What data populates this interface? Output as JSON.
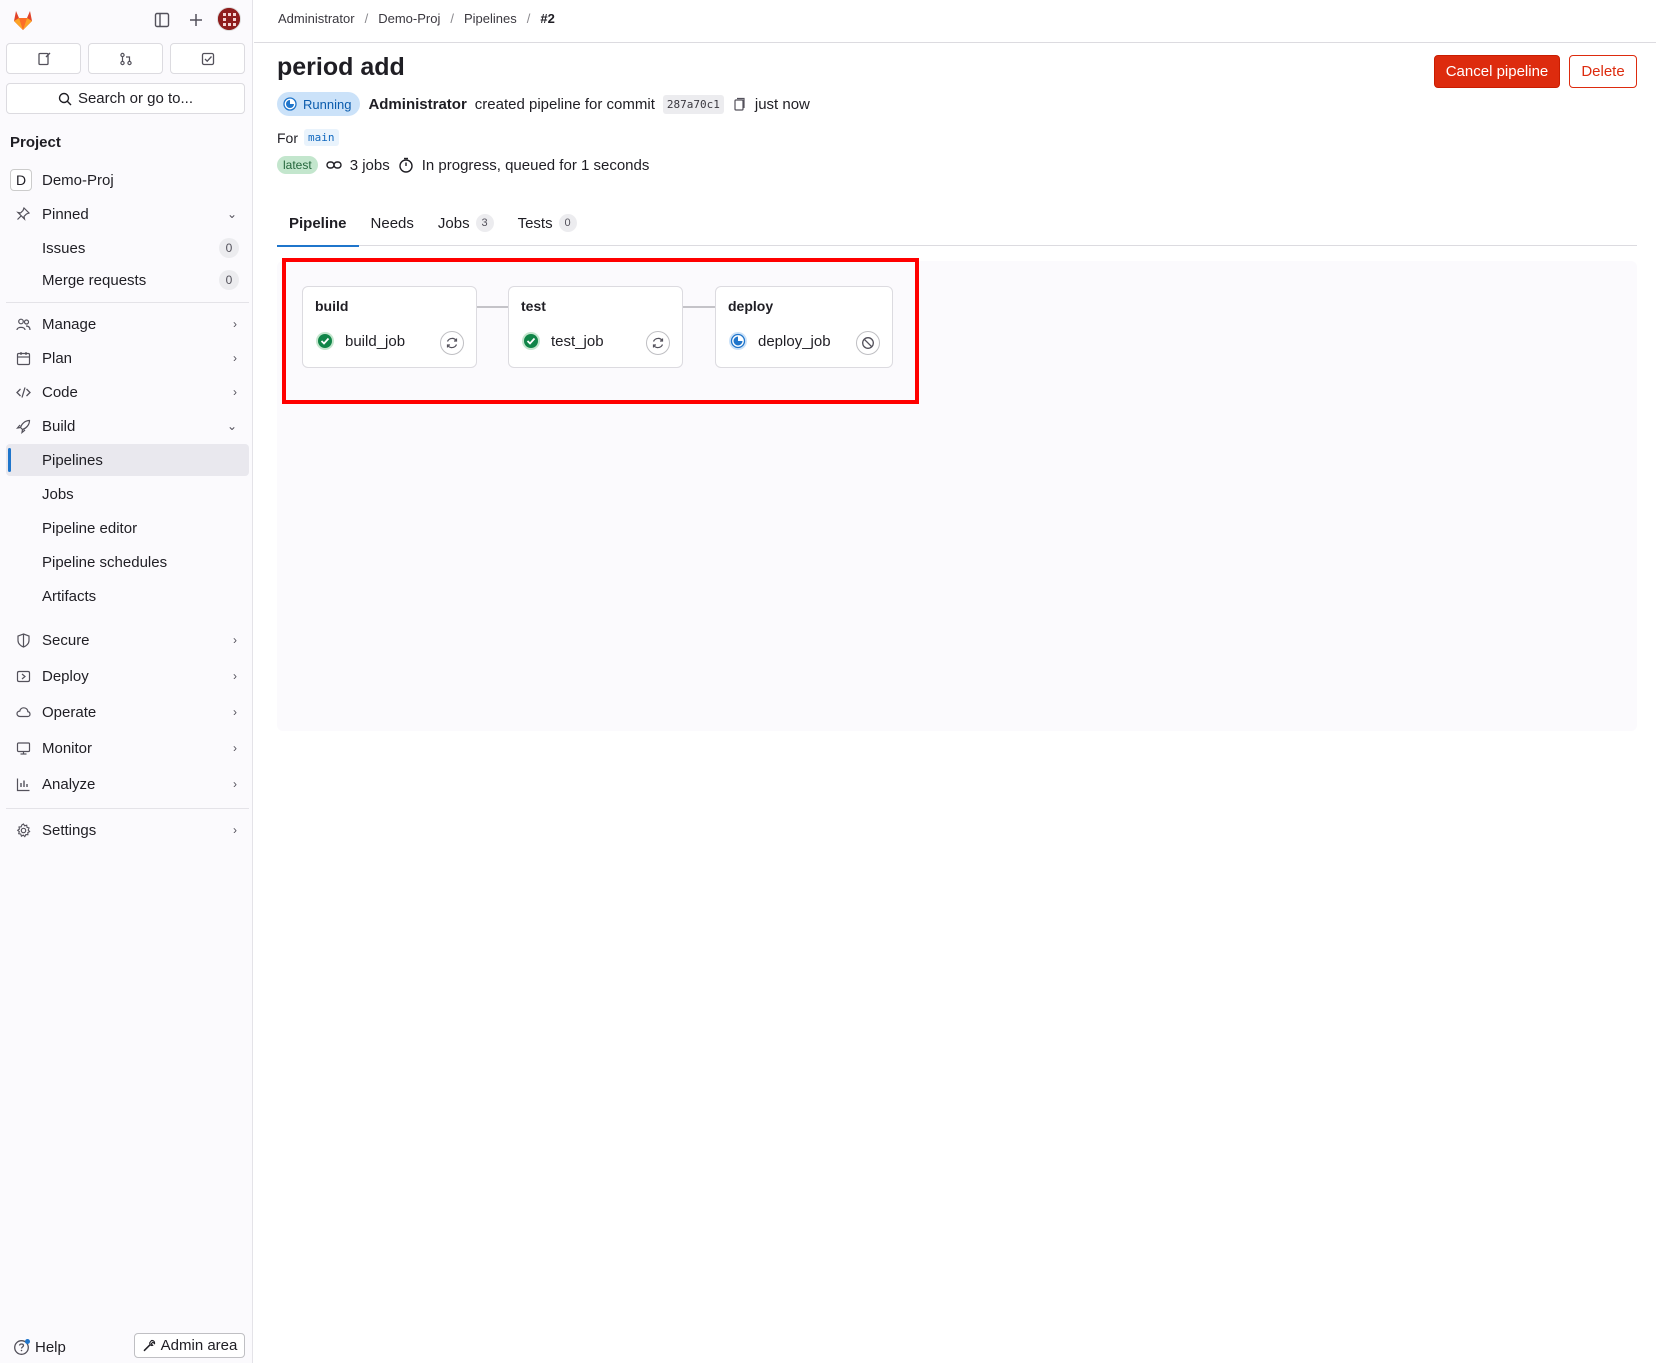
{
  "sidebar": {
    "search_label": "Search or go to...",
    "section": "Project",
    "project": {
      "letter": "D",
      "name": "Demo-Proj"
    },
    "pinned": {
      "label": "Pinned",
      "items": [
        {
          "label": "Issues",
          "count": "0"
        },
        {
          "label": "Merge requests",
          "count": "0"
        }
      ]
    },
    "nav": [
      {
        "label": "Manage",
        "icon": "users-icon"
      },
      {
        "label": "Plan",
        "icon": "calendar-icon"
      },
      {
        "label": "Code",
        "icon": "code-icon"
      },
      {
        "label": "Build",
        "icon": "rocket-icon"
      }
    ],
    "build_items": [
      "Pipelines",
      "Jobs",
      "Pipeline editor",
      "Pipeline schedules",
      "Artifacts"
    ],
    "nav_after": [
      {
        "label": "Secure",
        "icon": "shield-icon"
      },
      {
        "label": "Deploy",
        "icon": "deploy-icon"
      },
      {
        "label": "Operate",
        "icon": "cloud-icon"
      },
      {
        "label": "Monitor",
        "icon": "monitor-icon"
      },
      {
        "label": "Analyze",
        "icon": "chart-icon"
      }
    ],
    "settings": "Settings",
    "help": "Help",
    "admin": "Admin area"
  },
  "breadcrumb": [
    "Administrator",
    "Demo-Proj",
    "Pipelines",
    "#2"
  ],
  "pipeline": {
    "title": "period add",
    "status": "Running",
    "author": "Administrator",
    "action_text": "created pipeline for commit",
    "commit": "287a70c1",
    "time": "just now",
    "for_label": "For",
    "ref": "main",
    "latest": "latest",
    "jobs_text": "3 jobs",
    "progress_text": "In progress, queued for 1 seconds",
    "cancel_label": "Cancel pipeline",
    "delete_label": "Delete"
  },
  "tabs": [
    {
      "label": "Pipeline",
      "count": ""
    },
    {
      "label": "Needs",
      "count": ""
    },
    {
      "label": "Jobs",
      "count": "3"
    },
    {
      "label": "Tests",
      "count": "0"
    }
  ],
  "stages": [
    {
      "name": "build",
      "job": "build_job",
      "status": "success",
      "action": "retry-icon"
    },
    {
      "name": "test",
      "job": "test_job",
      "status": "success",
      "action": "retry-icon"
    },
    {
      "name": "deploy",
      "job": "deploy_job",
      "status": "running",
      "action": "cancel-icon"
    }
  ],
  "colors": {
    "accent": "#1f75cb",
    "danger": "#dd2b0e",
    "success": "#108548",
    "running": "#1f75cb"
  }
}
